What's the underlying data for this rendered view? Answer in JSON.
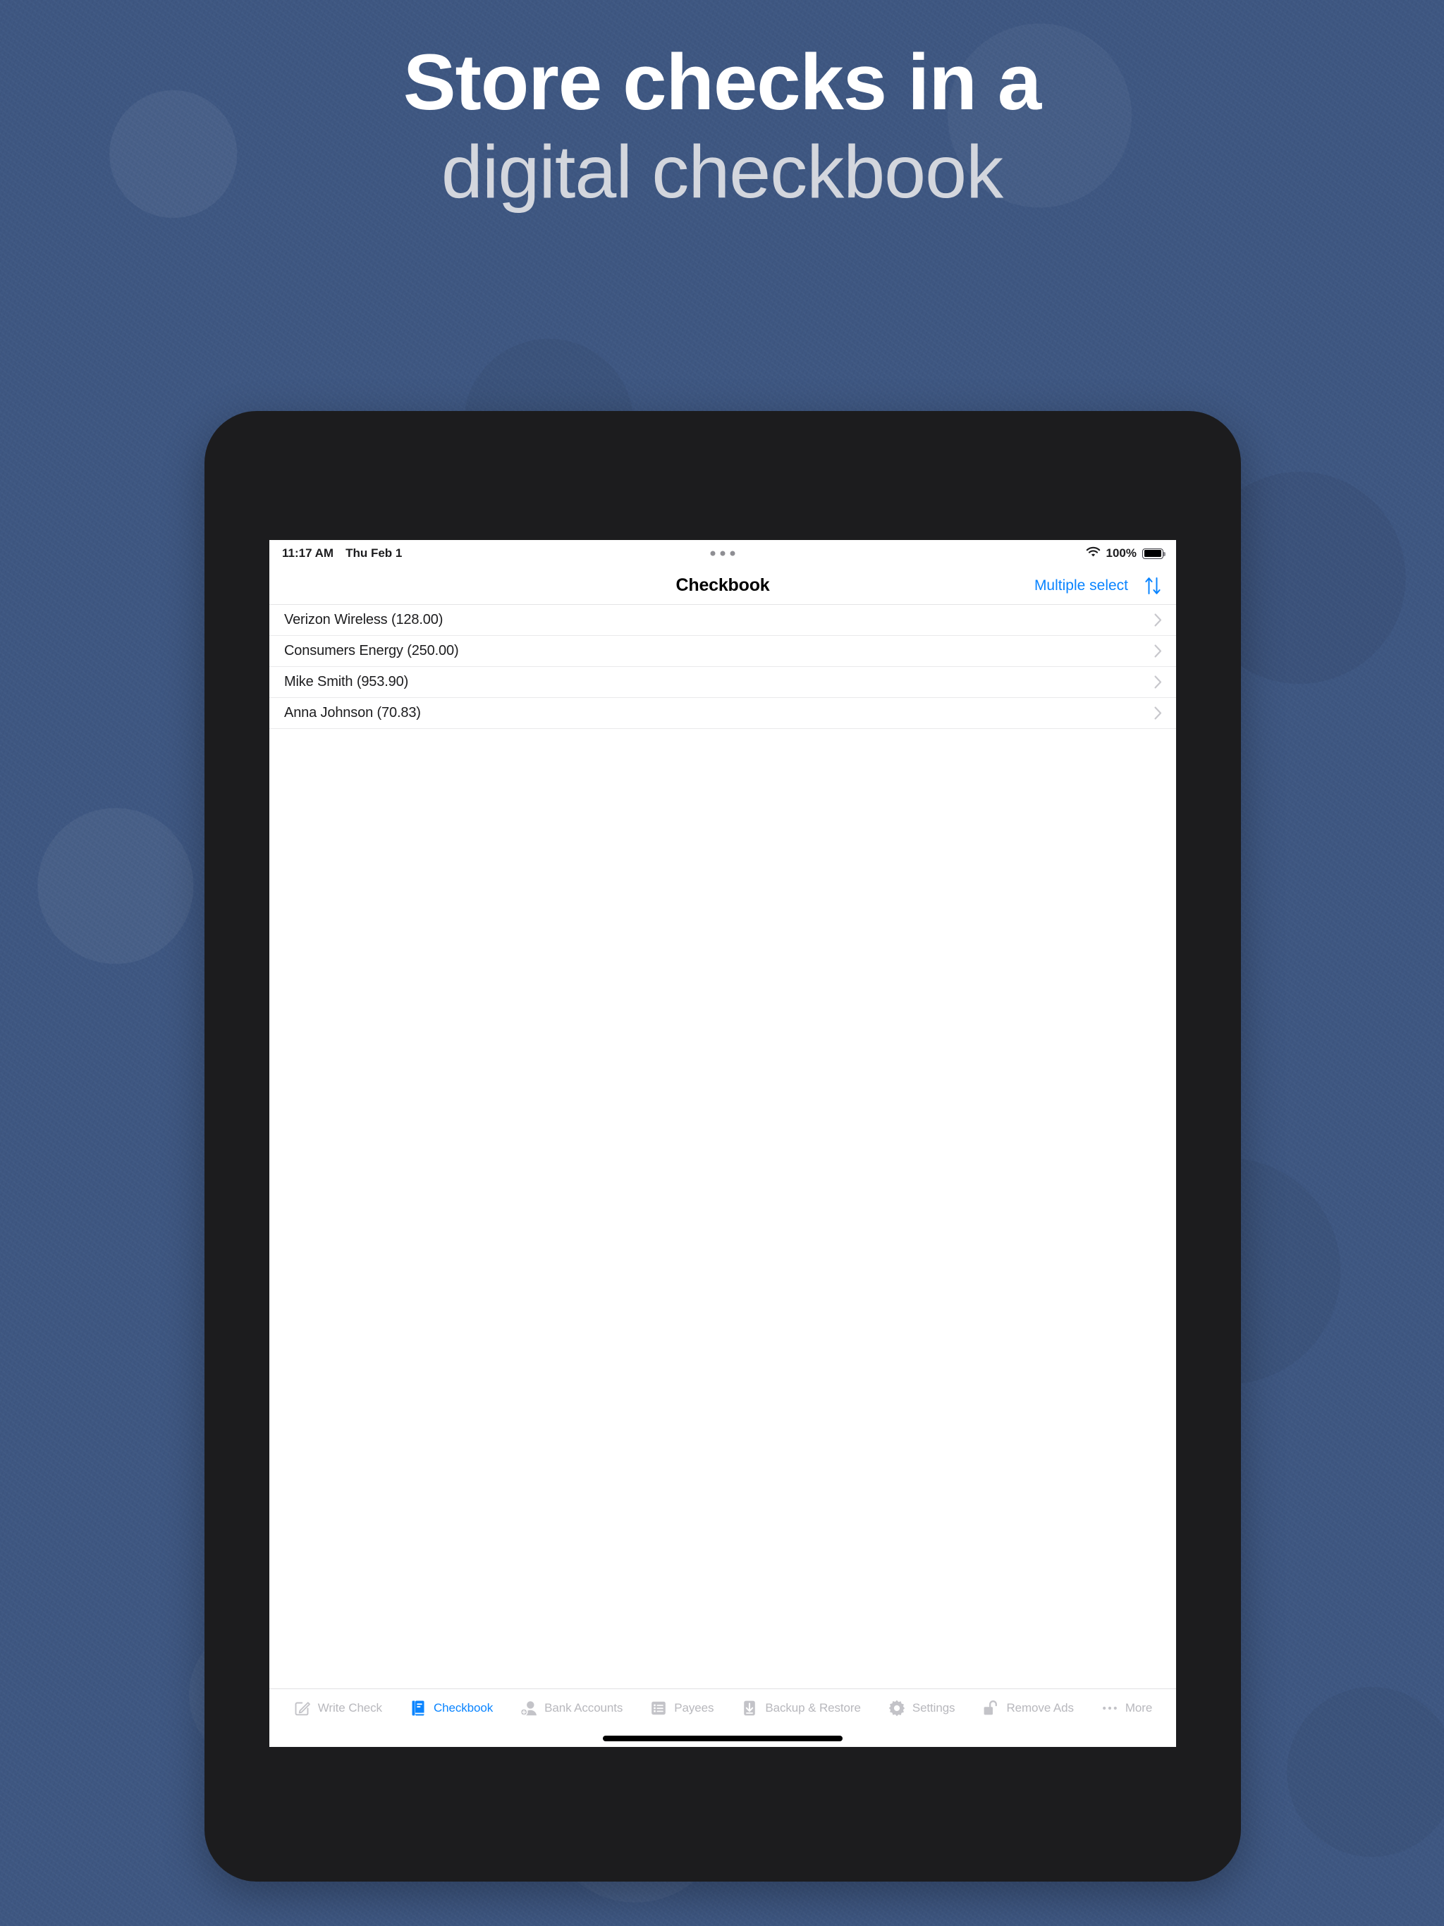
{
  "promo": {
    "headline_line1": "Store checks in a",
    "headline_line2": "digital checkbook",
    "background_color": "#3e5782",
    "headline_color_1": "#ffffff",
    "headline_color_2": "#d3d6dd"
  },
  "device": {
    "bezel_color": "#1c1c1e",
    "screen_background": "#ffffff"
  },
  "status_bar": {
    "time": "11:17 AM",
    "date": "Thu Feb 1",
    "multitask_indicator": "three-dots",
    "wifi_icon": "wifi-icon",
    "battery_percent": "100%",
    "battery_icon": "battery-full-icon"
  },
  "nav_bar": {
    "title": "Checkbook",
    "multiple_select_label": "Multiple select",
    "sort_icon": "sort-arrows-icon",
    "accent_color": "#0a84ff"
  },
  "list": {
    "rows": [
      {
        "label": "Verizon Wireless (128.00)",
        "payee": "Verizon Wireless",
        "amount": "128.00"
      },
      {
        "label": "Consumers Energy (250.00)",
        "payee": "Consumers Energy",
        "amount": "250.00"
      },
      {
        "label": "Mike Smith (953.90)",
        "payee": "Mike Smith",
        "amount": "953.90"
      },
      {
        "label": "Anna Johnson (70.83)",
        "payee": "Anna Johnson",
        "amount": "70.83"
      }
    ],
    "disclosure_icon": "chevron-right-icon"
  },
  "tab_bar": {
    "active_index": 1,
    "active_color": "#0a84ff",
    "inactive_color": "#b8b8bd",
    "tabs": [
      {
        "label": "Write Check",
        "icon": "write-check-icon"
      },
      {
        "label": "Checkbook",
        "icon": "book-icon"
      },
      {
        "label": "Bank Accounts",
        "icon": "add-person-icon"
      },
      {
        "label": "Payees",
        "icon": "list-icon"
      },
      {
        "label": "Backup & Restore",
        "icon": "download-icon"
      },
      {
        "label": "Settings",
        "icon": "gear-icon"
      },
      {
        "label": "Remove Ads",
        "icon": "unlock-icon"
      },
      {
        "label": "More",
        "icon": "ellipsis-icon"
      }
    ],
    "home_indicator": "home-indicator-bar"
  }
}
